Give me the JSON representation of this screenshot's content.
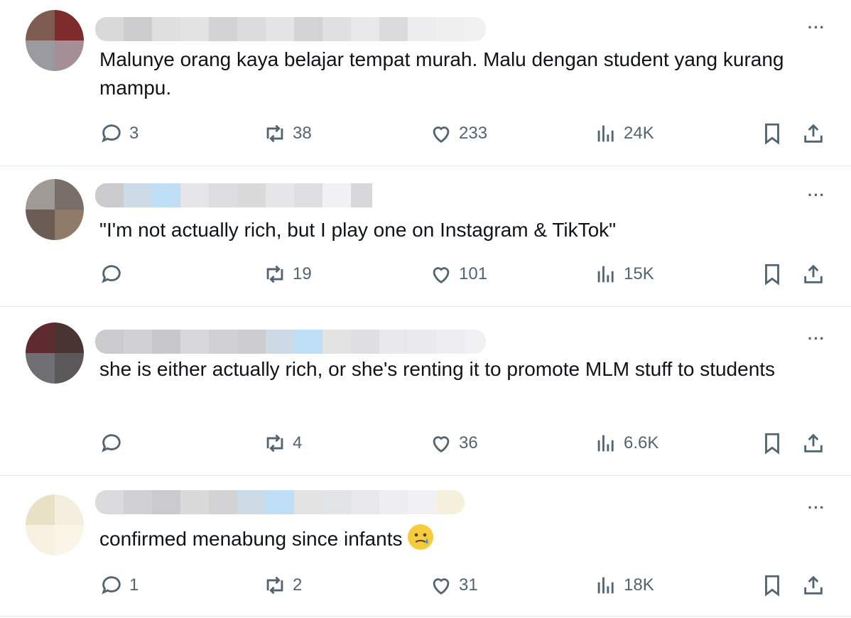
{
  "colors": {
    "text": "#0f1419",
    "muted": "#536471",
    "divider": "#e6e9eb"
  },
  "more_label": "···",
  "tweets": [
    {
      "text": "Malunye orang kaya belajar tempat murah. Malu dengan student yang kurang mampu.",
      "replies": "3",
      "retweets": "38",
      "likes": "233",
      "views": "24K"
    },
    {
      "text": "\"I'm not actually rich, but I play one on Instagram & TikTok\"",
      "replies": "",
      "retweets": "19",
      "likes": "101",
      "views": "15K"
    },
    {
      "text": "she is either actually rich, or she's renting it to promote MLM stuff to students",
      "replies": "",
      "retweets": "4",
      "likes": "36",
      "views": "6.6K"
    },
    {
      "text": "confirmed menabung since infants",
      "emoji": "face-holding-back-tears-icon",
      "replies": "1",
      "retweets": "2",
      "likes": "31",
      "views": "18K"
    }
  ]
}
